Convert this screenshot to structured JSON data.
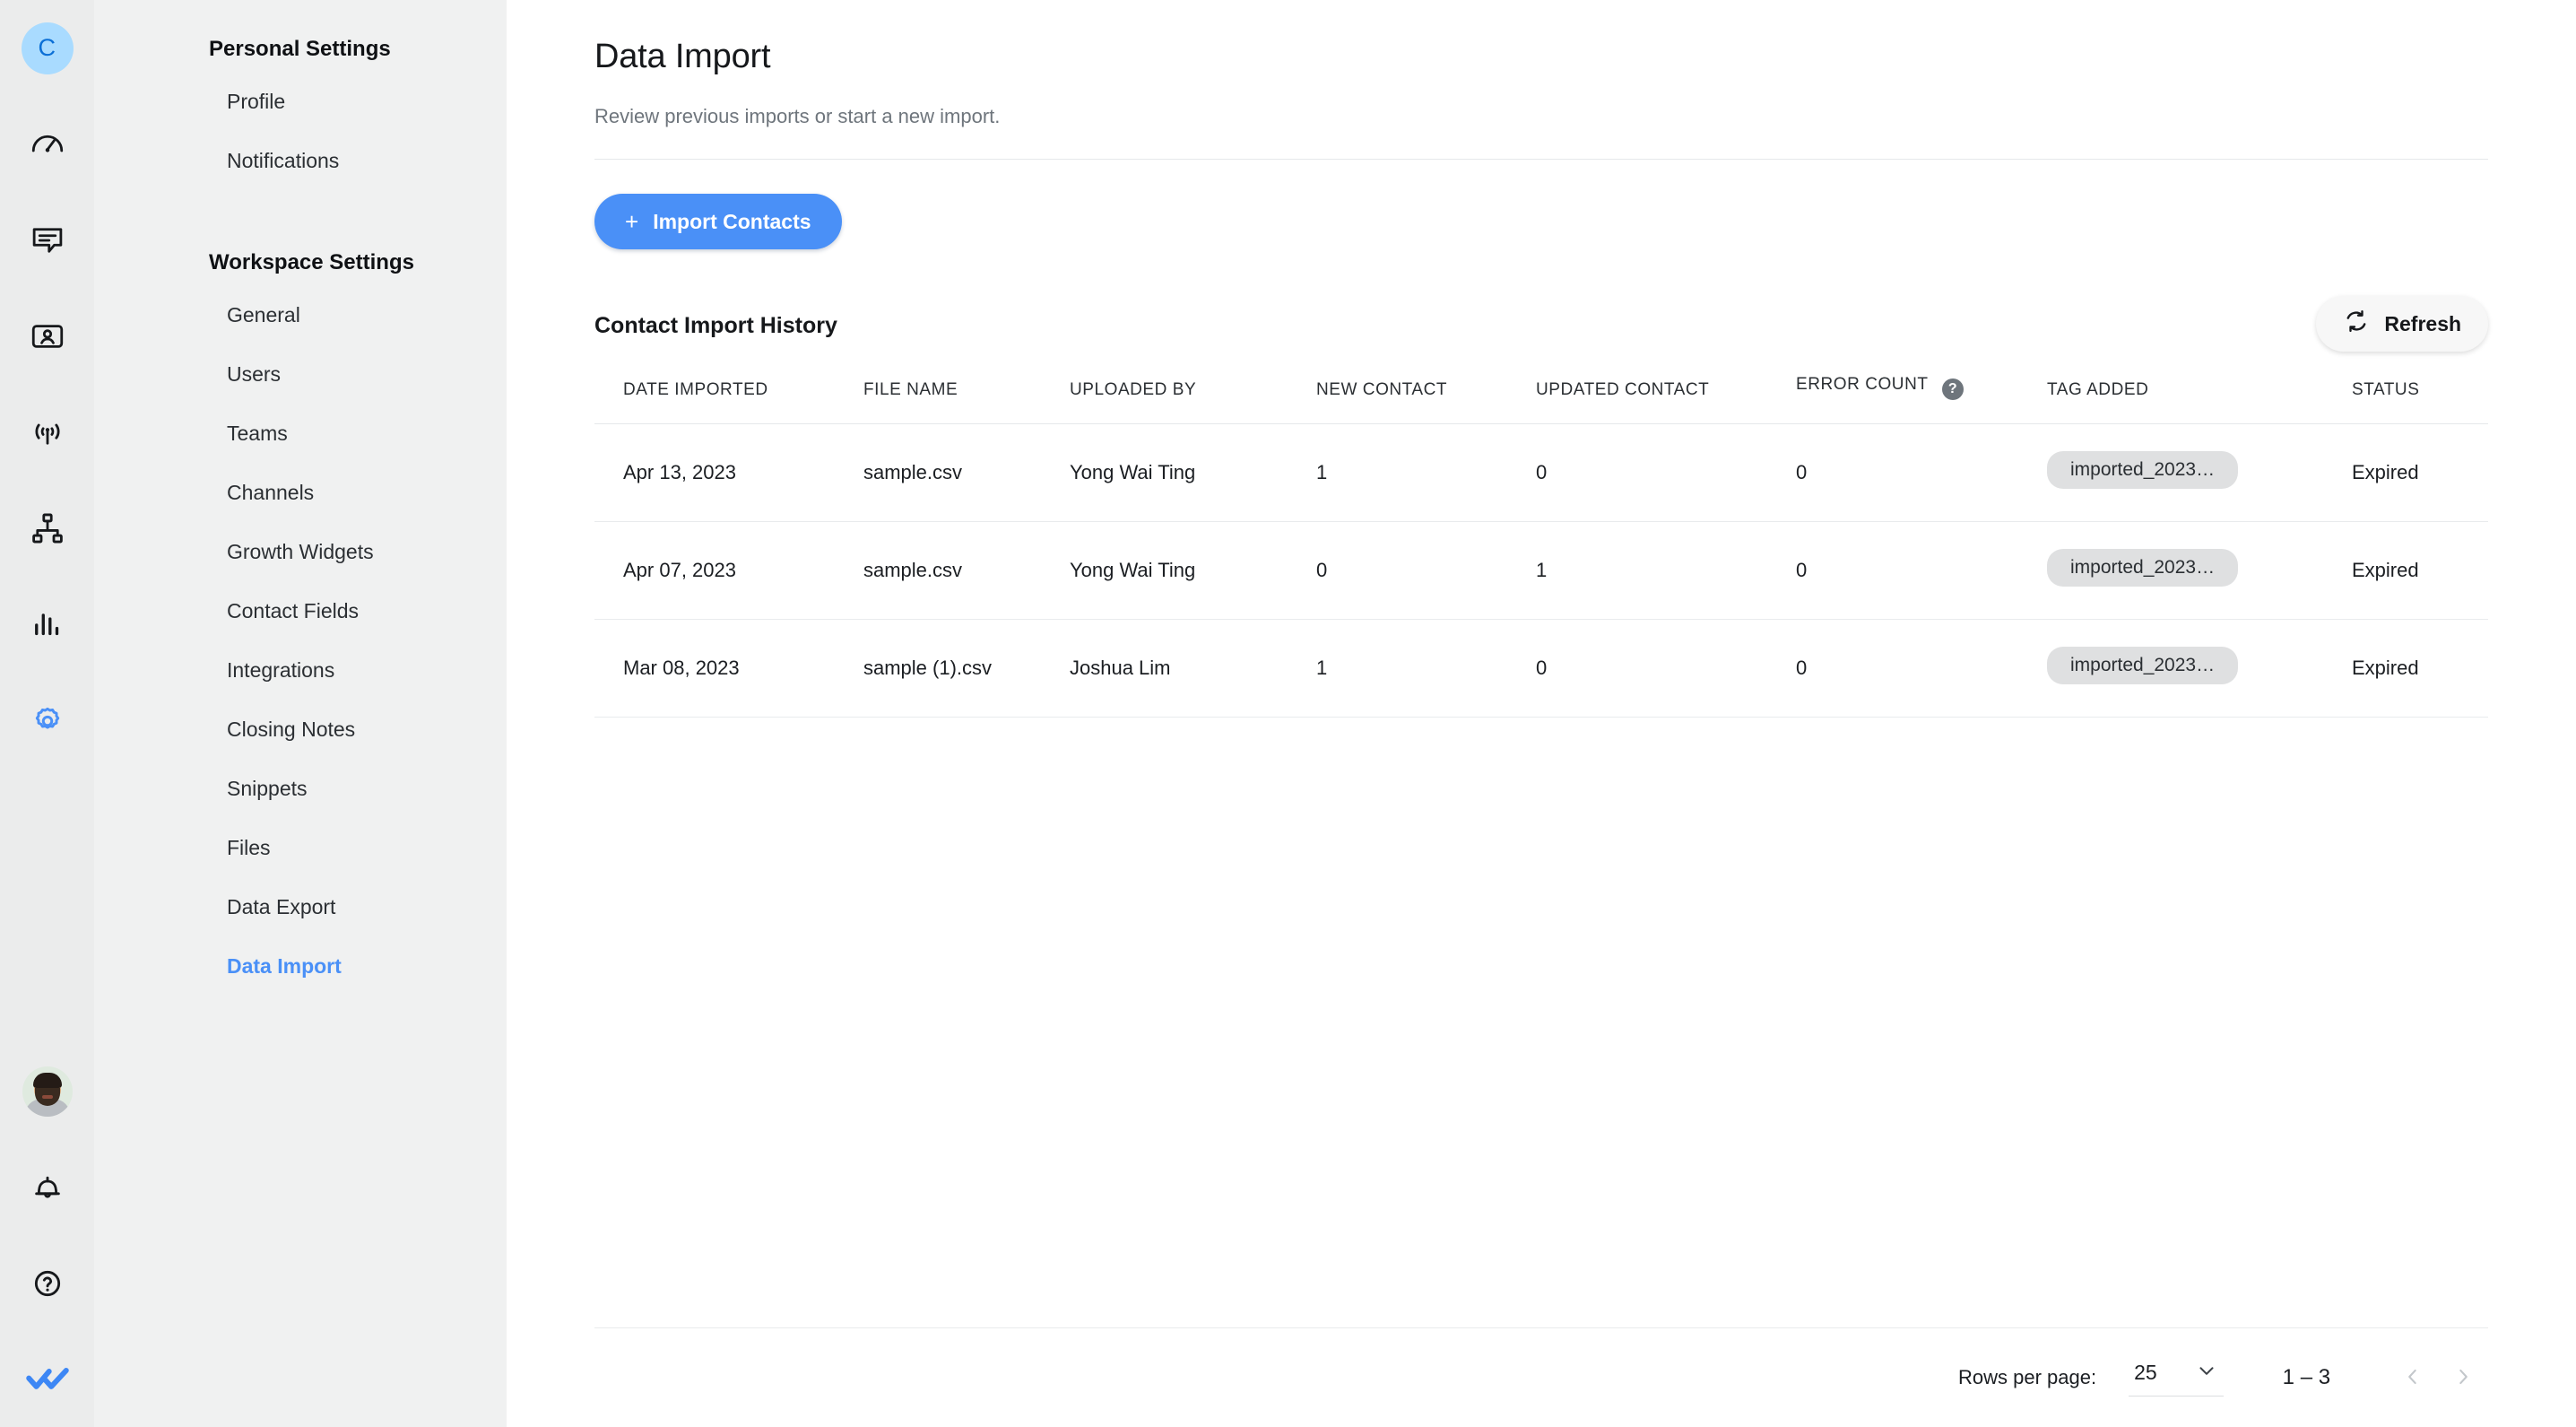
{
  "brand": {
    "workspace_initial": "C",
    "rail_icons": [
      {
        "name": "dashboard-speedometer-icon"
      },
      {
        "name": "chat-message-icon"
      },
      {
        "name": "contacts-card-icon"
      },
      {
        "name": "broadcast-icon"
      },
      {
        "name": "workflow-org-icon"
      },
      {
        "name": "analytics-bars-icon"
      },
      {
        "name": "settings-gear-icon"
      }
    ],
    "rail_bottom_icons": [
      {
        "name": "user-avatar-photo"
      },
      {
        "name": "notification-bell-icon"
      },
      {
        "name": "help-question-icon"
      },
      {
        "name": "respond-io-logo-icon"
      }
    ]
  },
  "sidebar": {
    "sections": [
      {
        "title": "Personal Settings",
        "items": [
          {
            "label": "Profile",
            "active": false
          },
          {
            "label": "Notifications",
            "active": false
          }
        ]
      },
      {
        "title": "Workspace Settings",
        "items": [
          {
            "label": "General",
            "active": false
          },
          {
            "label": "Users",
            "active": false
          },
          {
            "label": "Teams",
            "active": false
          },
          {
            "label": "Channels",
            "active": false
          },
          {
            "label": "Growth Widgets",
            "active": false
          },
          {
            "label": "Contact Fields",
            "active": false
          },
          {
            "label": "Integrations",
            "active": false
          },
          {
            "label": "Closing Notes",
            "active": false
          },
          {
            "label": "Snippets",
            "active": false
          },
          {
            "label": "Files",
            "active": false
          },
          {
            "label": "Data Export",
            "active": false
          },
          {
            "label": "Data Import",
            "active": true
          }
        ]
      }
    ]
  },
  "page": {
    "title": "Data Import",
    "subtitle": "Review previous imports or start a new import.",
    "import_button": "Import Contacts",
    "import_button_plus": "+"
  },
  "history": {
    "section_title": "Contact Import History",
    "refresh_label": "Refresh",
    "error_count_help": "?",
    "columns": [
      "DATE IMPORTED",
      "FILE NAME",
      "UPLOADED BY",
      "NEW CONTACT",
      "UPDATED CONTACT",
      "ERROR COUNT",
      "TAG ADDED",
      "STATUS"
    ],
    "rows": [
      {
        "date_imported": "Apr 13, 2023",
        "file_name": "sample.csv",
        "uploaded_by": "Yong Wai Ting",
        "new_contact": "1",
        "updated_contact": "0",
        "error_count": "0",
        "tag_added": "imported_2023…",
        "status": "Expired"
      },
      {
        "date_imported": "Apr 07, 2023",
        "file_name": "sample.csv",
        "uploaded_by": "Yong Wai Ting",
        "new_contact": "0",
        "updated_contact": "1",
        "error_count": "0",
        "tag_added": "imported_2023…",
        "status": "Expired"
      },
      {
        "date_imported": "Mar 08, 2023",
        "file_name": "sample (1).csv",
        "uploaded_by": "Joshua Lim",
        "new_contact": "1",
        "updated_contact": "0",
        "error_count": "0",
        "tag_added": "imported_2023…",
        "status": "Expired"
      }
    ]
  },
  "pagination": {
    "rows_per_page_label": "Rows per page:",
    "rows_per_page_value": "25",
    "range": "1 – 3"
  },
  "colors": {
    "accent": "#4a90f7",
    "rail_bg": "#ebecec",
    "nav_bg": "#f0f1f1",
    "tag_bg": "#dfe0e1",
    "text": "#1b1e22",
    "muted": "#6e757c"
  }
}
